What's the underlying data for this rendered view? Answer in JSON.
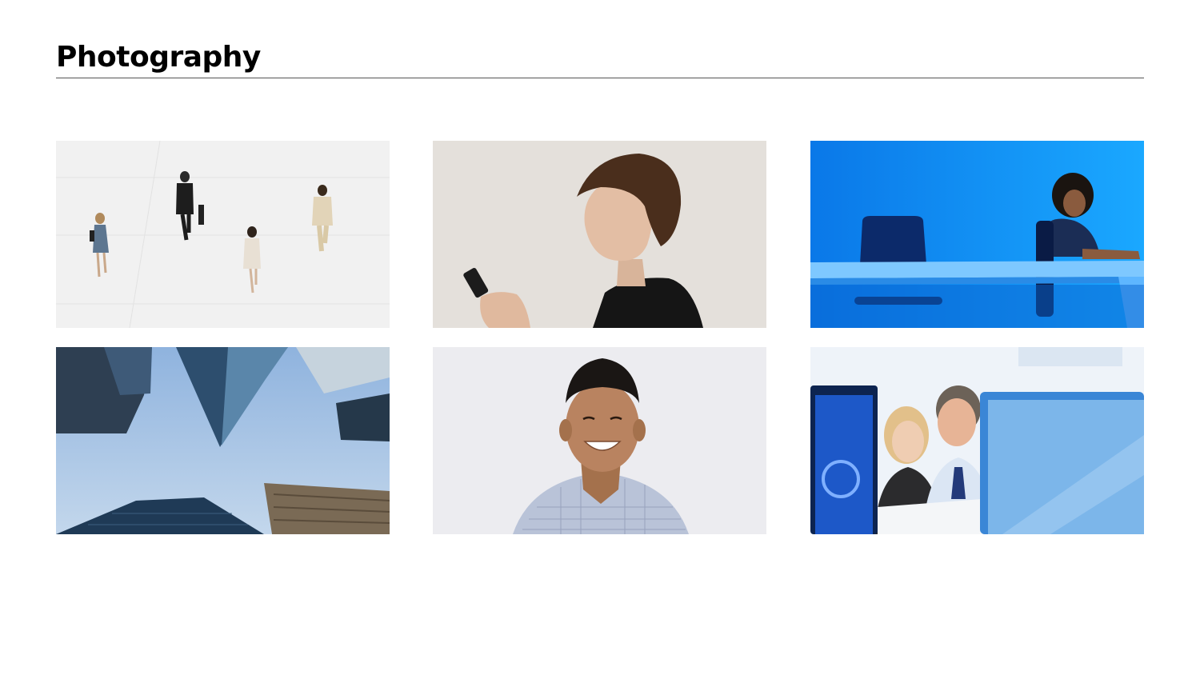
{
  "page": {
    "title": "Photography"
  },
  "colors": {
    "title": "#000000",
    "rule": "#555555",
    "background": "#ffffff"
  },
  "photos": [
    {
      "subject": "people-walking-overhead"
    },
    {
      "subject": "woman-with-phone"
    },
    {
      "subject": "woman-at-desk-blue"
    },
    {
      "subject": "skyscrapers-looking-up"
    },
    {
      "subject": "smiling-man"
    },
    {
      "subject": "colleagues-at-monitors"
    }
  ]
}
